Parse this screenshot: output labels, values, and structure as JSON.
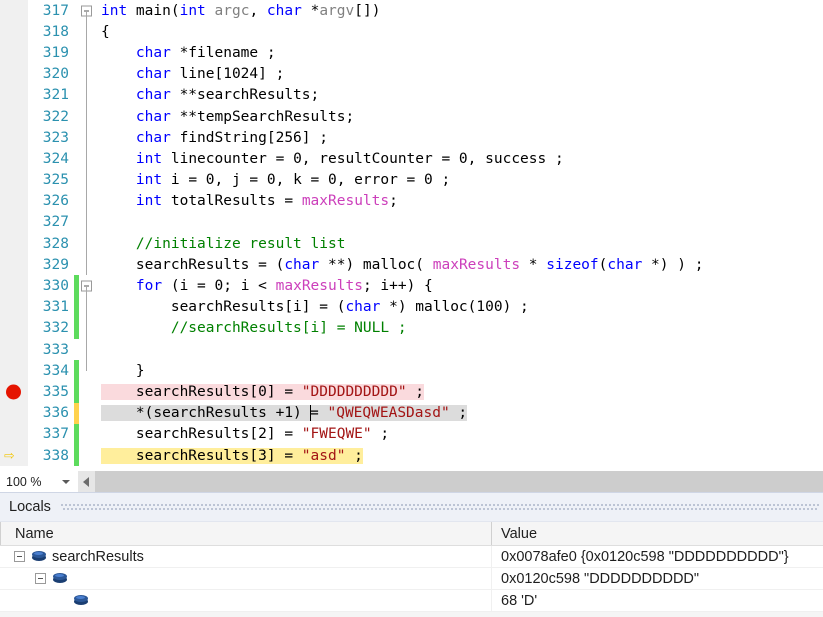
{
  "editor": {
    "zoom_level": "100 %",
    "lines": [
      {
        "num": "317",
        "fold": "start",
        "change": "",
        "marker": "",
        "highlight": "",
        "tokens": [
          {
            "t": "int",
            "c": "kw"
          },
          {
            "t": " main(",
            "c": "pun"
          },
          {
            "t": "int",
            "c": "kw"
          },
          {
            "t": " ",
            "c": "pun"
          },
          {
            "t": "argc",
            "c": "gray"
          },
          {
            "t": ", ",
            "c": "pun"
          },
          {
            "t": "char",
            "c": "kw"
          },
          {
            "t": " *",
            "c": "pun"
          },
          {
            "t": "argv",
            "c": "gray"
          },
          {
            "t": "[])",
            "c": "pun"
          }
        ]
      },
      {
        "num": "318",
        "fold": "line",
        "change": "",
        "marker": "",
        "highlight": "",
        "tokens": [
          {
            "t": "{",
            "c": "pun"
          }
        ]
      },
      {
        "num": "319",
        "fold": "line",
        "change": "",
        "marker": "",
        "highlight": "",
        "tokens": [
          {
            "t": "    ",
            "c": "pun"
          },
          {
            "t": "char",
            "c": "kw"
          },
          {
            "t": " *filename ;",
            "c": "pun"
          }
        ]
      },
      {
        "num": "320",
        "fold": "line",
        "change": "",
        "marker": "",
        "highlight": "",
        "tokens": [
          {
            "t": "    ",
            "c": "pun"
          },
          {
            "t": "char",
            "c": "kw"
          },
          {
            "t": " line[1024] ;",
            "c": "pun"
          }
        ]
      },
      {
        "num": "321",
        "fold": "line",
        "change": "",
        "marker": "",
        "highlight": "",
        "tokens": [
          {
            "t": "    ",
            "c": "pun"
          },
          {
            "t": "char",
            "c": "kw"
          },
          {
            "t": " **searchResults;",
            "c": "pun"
          }
        ]
      },
      {
        "num": "322",
        "fold": "line",
        "change": "",
        "marker": "",
        "highlight": "",
        "tokens": [
          {
            "t": "    ",
            "c": "pun"
          },
          {
            "t": "char",
            "c": "kw"
          },
          {
            "t": " **tempSearchResults;",
            "c": "pun"
          }
        ]
      },
      {
        "num": "323",
        "fold": "line",
        "change": "",
        "marker": "",
        "highlight": "",
        "tokens": [
          {
            "t": "    ",
            "c": "pun"
          },
          {
            "t": "char",
            "c": "kw"
          },
          {
            "t": " findString[256] ;",
            "c": "pun"
          }
        ]
      },
      {
        "num": "324",
        "fold": "line",
        "change": "",
        "marker": "",
        "highlight": "",
        "tokens": [
          {
            "t": "    ",
            "c": "pun"
          },
          {
            "t": "int",
            "c": "kw"
          },
          {
            "t": " linecounter = 0, resultCounter = 0, success ;",
            "c": "pun"
          }
        ]
      },
      {
        "num": "325",
        "fold": "line",
        "change": "",
        "marker": "",
        "highlight": "",
        "tokens": [
          {
            "t": "    ",
            "c": "pun"
          },
          {
            "t": "int",
            "c": "kw"
          },
          {
            "t": " i = 0, j = 0, k = 0, error = 0 ;",
            "c": "pun"
          }
        ]
      },
      {
        "num": "326",
        "fold": "line",
        "change": "",
        "marker": "",
        "highlight": "",
        "tokens": [
          {
            "t": "    ",
            "c": "pun"
          },
          {
            "t": "int",
            "c": "kw"
          },
          {
            "t": " totalResults = ",
            "c": "pun"
          },
          {
            "t": "maxResults",
            "c": "mac"
          },
          {
            "t": ";",
            "c": "pun"
          }
        ]
      },
      {
        "num": "327",
        "fold": "line",
        "change": "",
        "marker": "",
        "highlight": "",
        "tokens": [
          {
            "t": "",
            "c": "pun"
          }
        ]
      },
      {
        "num": "328",
        "fold": "line",
        "change": "",
        "marker": "",
        "highlight": "",
        "tokens": [
          {
            "t": "    ",
            "c": "pun"
          },
          {
            "t": "//initialize result list",
            "c": "cmt"
          }
        ]
      },
      {
        "num": "329",
        "fold": "line",
        "change": "",
        "marker": "",
        "highlight": "",
        "tokens": [
          {
            "t": "    searchResults = (",
            "c": "pun"
          },
          {
            "t": "char",
            "c": "kw"
          },
          {
            "t": " **) malloc( ",
            "c": "pun"
          },
          {
            "t": "maxResults",
            "c": "mac"
          },
          {
            "t": " * ",
            "c": "pun"
          },
          {
            "t": "sizeof",
            "c": "kw"
          },
          {
            "t": "(",
            "c": "pun"
          },
          {
            "t": "char",
            "c": "kw"
          },
          {
            "t": " *) ) ;",
            "c": "pun"
          }
        ]
      },
      {
        "num": "330",
        "fold": "start",
        "change": "green",
        "marker": "",
        "highlight": "",
        "tokens": [
          {
            "t": "    ",
            "c": "pun"
          },
          {
            "t": "for",
            "c": "kw"
          },
          {
            "t": " (i = 0; i < ",
            "c": "pun"
          },
          {
            "t": "maxResults",
            "c": "mac"
          },
          {
            "t": "; i++) {",
            "c": "pun"
          }
        ]
      },
      {
        "num": "331",
        "fold": "line",
        "change": "green",
        "marker": "",
        "highlight": "",
        "tokens": [
          {
            "t": "        searchResults[i] = (",
            "c": "pun"
          },
          {
            "t": "char",
            "c": "kw"
          },
          {
            "t": " *) malloc(100) ;",
            "c": "pun"
          }
        ]
      },
      {
        "num": "332",
        "fold": "line",
        "change": "green",
        "marker": "",
        "highlight": "",
        "tokens": [
          {
            "t": "        ",
            "c": "pun"
          },
          {
            "t": "//searchResults[i] = NULL ;",
            "c": "cmt"
          }
        ]
      },
      {
        "num": "333",
        "fold": "line",
        "change": "",
        "marker": "",
        "highlight": "",
        "tokens": [
          {
            "t": "",
            "c": "pun"
          }
        ]
      },
      {
        "num": "334",
        "fold": "end",
        "change": "green",
        "marker": "",
        "highlight": "",
        "tokens": [
          {
            "t": "    }",
            "c": "pun"
          }
        ]
      },
      {
        "num": "335",
        "fold": "",
        "change": "green",
        "marker": "breakpoint",
        "highlight": "hl-bp",
        "tokens": [
          {
            "t": "    searchResults[0] = ",
            "c": "pun"
          },
          {
            "t": "\"DDDDDDDDDD\"",
            "c": "str"
          },
          {
            "t": " ;",
            "c": "pun"
          }
        ]
      },
      {
        "num": "336",
        "fold": "",
        "change": "yellow",
        "marker": "",
        "highlight": "hl-cur",
        "tokens": [
          {
            "t": "    *(searchResults +1) ",
            "c": "pun"
          },
          {
            "t": "|CARET|",
            "c": "caret"
          },
          {
            "t": "= ",
            "c": "pun"
          },
          {
            "t": "\"QWEQWEASDasd\"",
            "c": "str"
          },
          {
            "t": " ;",
            "c": "pun"
          }
        ]
      },
      {
        "num": "337",
        "fold": "",
        "change": "green",
        "marker": "",
        "highlight": "",
        "tokens": [
          {
            "t": "    searchResults[2] = ",
            "c": "pun"
          },
          {
            "t": "\"FWEQWE\"",
            "c": "str"
          },
          {
            "t": " ;",
            "c": "pun"
          }
        ]
      },
      {
        "num": "338",
        "fold": "",
        "change": "green",
        "marker": "execution",
        "highlight": "hl-exec",
        "tokens": [
          {
            "t": "    searchResults[3] = ",
            "c": "pun"
          },
          {
            "t": "\"asd\"",
            "c": "str"
          },
          {
            "t": " ;",
            "c": "pun"
          }
        ]
      }
    ]
  },
  "locals": {
    "title": "Locals",
    "columns": {
      "name": "Name",
      "value": "Value"
    },
    "rows": [
      {
        "indent": 0,
        "expander": "expanded",
        "name": "searchResults",
        "value": "0x0078afe0 {0x0120c598 \"DDDDDDDDDD\"}"
      },
      {
        "indent": 1,
        "expander": "expanded",
        "name": "",
        "value": "0x0120c598 \"DDDDDDDDDD\""
      },
      {
        "indent": 2,
        "expander": "none",
        "name": "",
        "value": "68 'D'"
      }
    ]
  }
}
